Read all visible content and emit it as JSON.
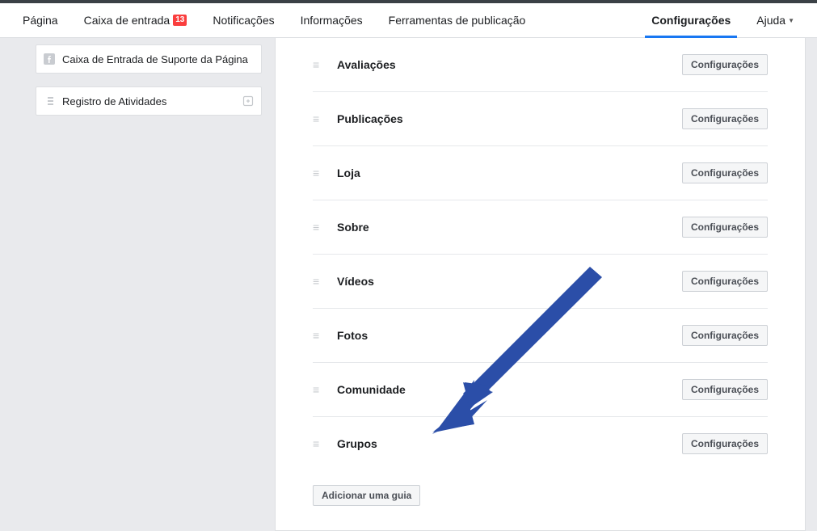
{
  "topnav": {
    "pagina": "Página",
    "inbox": "Caixa de entrada",
    "inbox_badge": "13",
    "notificacoes": "Notificações",
    "informacoes": "Informações",
    "ferramentas": "Ferramentas de publicação",
    "configuracoes": "Configurações",
    "ajuda": "Ajuda"
  },
  "sidebar": {
    "support_inbox": "Caixa de Entrada de Suporte da Página",
    "activity_log": "Registro de Atividades"
  },
  "tabs": [
    {
      "label": "Avaliações",
      "button": "Configurações"
    },
    {
      "label": "Publicações",
      "button": "Configurações"
    },
    {
      "label": "Loja",
      "button": "Configurações"
    },
    {
      "label": "Sobre",
      "button": "Configurações"
    },
    {
      "label": "Vídeos",
      "button": "Configurações"
    },
    {
      "label": "Fotos",
      "button": "Configurações"
    },
    {
      "label": "Comunidade",
      "button": "Configurações"
    },
    {
      "label": "Grupos",
      "button": "Configurações"
    }
  ],
  "add_tab_label": "Adicionar uma guia",
  "arrow_color": "#2b4ea8"
}
